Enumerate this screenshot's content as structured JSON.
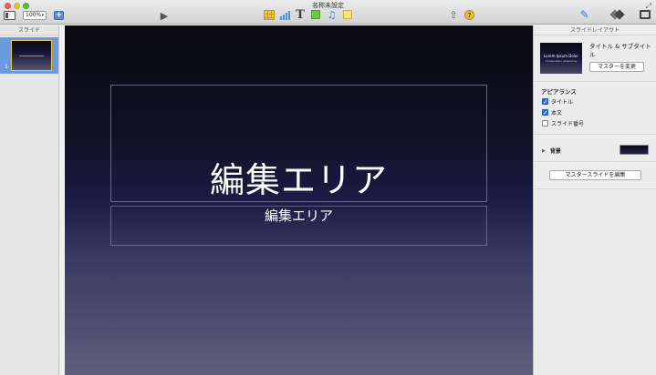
{
  "window": {
    "title": "名称未設定"
  },
  "toolbar": {
    "zoom_value": "100%",
    "add_label": "+",
    "play_icon": "play-icon",
    "icons": [
      "view-icon",
      "table-icon",
      "chart-icon",
      "text-icon",
      "shape-icon",
      "media-icon",
      "comment-icon",
      "share-icon",
      "help-icon",
      "format-icon",
      "animate-icon",
      "document-icon"
    ],
    "help_label": "?"
  },
  "navigator": {
    "header": "スライド",
    "slides": [
      {
        "number": "1",
        "selected": true
      }
    ]
  },
  "canvas": {
    "title": "編集エリア",
    "subtitle": "編集エリア",
    "background_top": "#09090f",
    "background_bottom": "#5f5e7c"
  },
  "inspector": {
    "header": "スライドレイアウト",
    "layout_name": "タイトル & サブタイトル",
    "thumbnail_title": "Lorem Ipsum Dolor",
    "thumbnail_subtitle": "Consectetur adipiscing",
    "change_master_label": "マスターを変更",
    "appearance_label": "アピアランス",
    "checkboxes": [
      {
        "label": "タイトル",
        "checked": true
      },
      {
        "label": "本文",
        "checked": true
      },
      {
        "label": "スライド番号",
        "checked": false
      }
    ],
    "background_label": "背景",
    "edit_master_label": "マスタースライドを編集"
  },
  "colors": {
    "accent": "#4a8ee6",
    "selection": "#6a9ae0",
    "thumb_border": "#f0c53a"
  }
}
